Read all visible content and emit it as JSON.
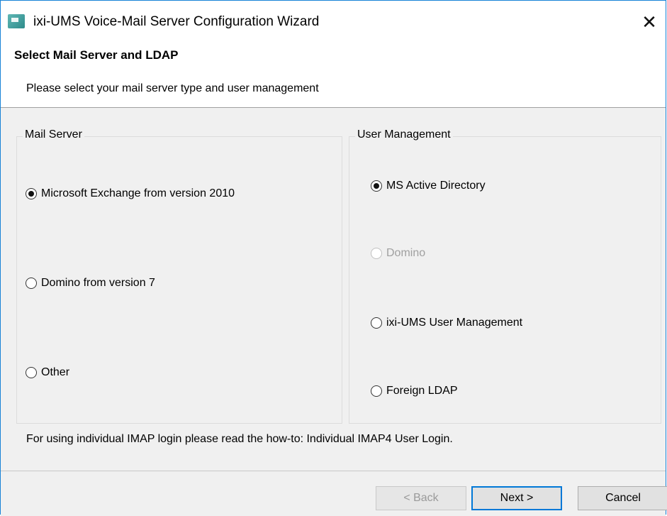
{
  "window": {
    "title": "ixi-UMS Voice-Mail Server Configuration Wizard",
    "close_glyph": "✕"
  },
  "header": {
    "title": "Select Mail Server and LDAP",
    "description": "Please select your mail server type and user management"
  },
  "mail_server": {
    "legend": "Mail Server",
    "options": [
      {
        "label": "Microsoft Exchange from version 2010",
        "checked": true,
        "enabled": true
      },
      {
        "label": "Domino from version 7",
        "checked": false,
        "enabled": true
      },
      {
        "label": "Other",
        "checked": false,
        "enabled": true
      }
    ]
  },
  "user_management": {
    "legend": "User Management",
    "options": [
      {
        "label": "MS Active Directory",
        "checked": true,
        "enabled": true
      },
      {
        "label": "Domino",
        "checked": false,
        "enabled": false
      },
      {
        "label": "ixi-UMS User Management",
        "checked": false,
        "enabled": true
      },
      {
        "label": "Foreign LDAP",
        "checked": false,
        "enabled": true
      }
    ]
  },
  "footer": {
    "note": "For using individual IMAP login please read the how-to: Individual IMAP4 User Login."
  },
  "buttons": {
    "back": "< Back",
    "next": "Next >",
    "cancel": "Cancel"
  }
}
